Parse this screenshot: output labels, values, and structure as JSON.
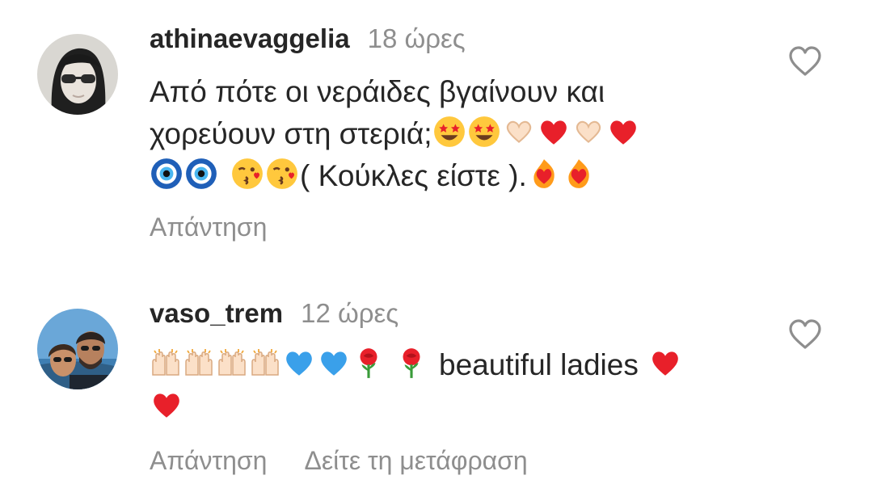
{
  "comments": [
    {
      "username": "athinaevaggelia",
      "time": "18 ώρες",
      "line1": "Από πότε οι νεράιδες βγαίνουν και",
      "line2_text": "χορεύουν στη στεριά;",
      "line3_text": "( Κούκλες είστε ).",
      "reply": "Απάντηση",
      "avatar_icon": "person-sunglasses-avatar",
      "like_icon": "heart-outline-icon"
    },
    {
      "username": "vaso_trem",
      "time": "12 ώρες",
      "text": "beautiful ladies",
      "reply": "Απάντηση",
      "translate": "Δείτε τη μετάφραση",
      "avatar_icon": "couple-photo-avatar",
      "like_icon": "heart-outline-icon"
    }
  ],
  "colors": {
    "username": "#262626",
    "meta": "#8e8e8e",
    "heart_red": "#e8202a",
    "blue_heart": "#3aa0ea"
  }
}
